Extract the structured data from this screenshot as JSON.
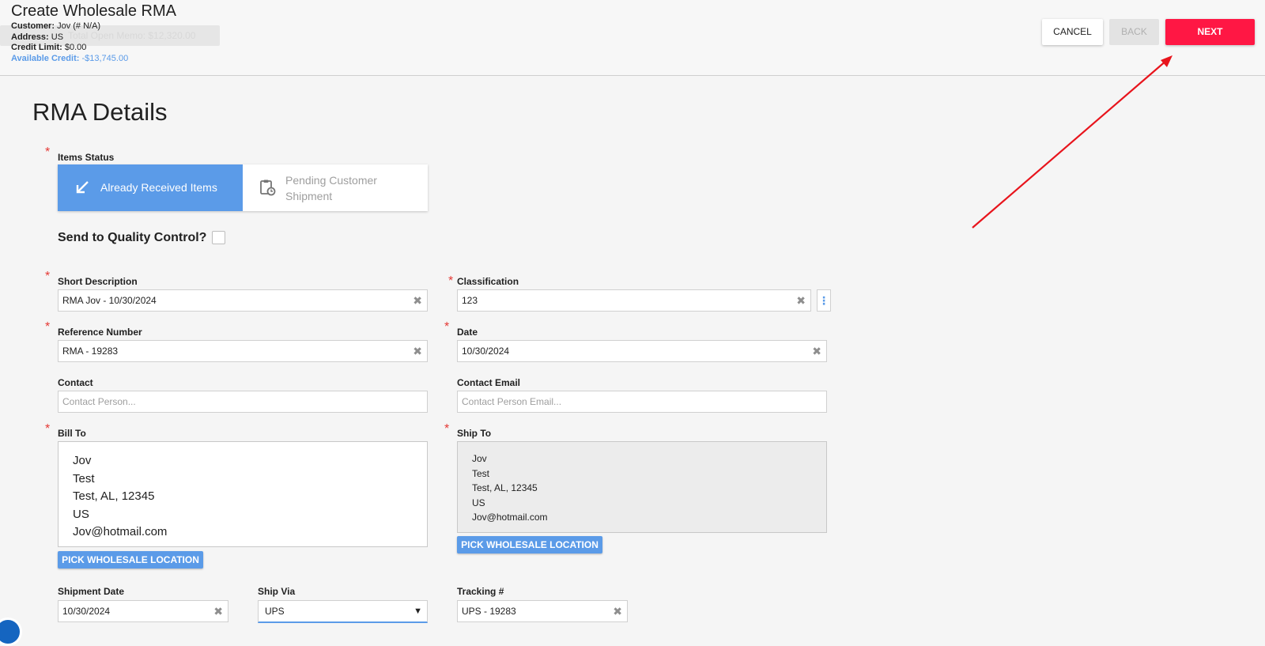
{
  "header": {
    "title": "Create Wholesale RMA",
    "ghost_memo": "Total Open Memo: $12,320.00",
    "customer_label": "Customer:",
    "customer_value": "Jov (# N/A)",
    "address_label": "Address:",
    "address_value": "US",
    "credit_limit_label": "Credit Limit:",
    "credit_limit_value": "$0.00",
    "available_credit_label": "Available Credit:",
    "available_credit_value": "-$13,745.00",
    "buttons": {
      "cancel": "CANCEL",
      "back": "BACK",
      "next": "NEXT"
    }
  },
  "section_title": "RMA Details",
  "required_mark": "*",
  "items_status": {
    "label": "Items Status",
    "options": [
      {
        "label": "Already Received Items",
        "icon": "arrow-down-left-icon",
        "selected": true
      },
      {
        "label": "Pending Customer Shipment",
        "icon": "clipboard-clock-icon",
        "selected": false
      }
    ]
  },
  "quality_control": {
    "label": "Send to Quality Control?",
    "checked": false
  },
  "form": {
    "short_description": {
      "label": "Short Description",
      "value": "RMA Jov - 10/30/2024",
      "clear": "✖"
    },
    "classification": {
      "label": "Classification",
      "value": "123",
      "clear": "✖",
      "menu": "⋮"
    },
    "reference_number": {
      "label": "Reference Number",
      "value": "RMA - 19283",
      "clear": "✖"
    },
    "date": {
      "label": "Date",
      "value": "10/30/2024",
      "clear": "✖"
    },
    "contact": {
      "label": "Contact",
      "placeholder": "Contact Person..."
    },
    "contact_email": {
      "label": "Contact Email",
      "placeholder": "Contact Person Email..."
    },
    "bill_to": {
      "label": "Bill To",
      "lines": [
        "Jov",
        "Test",
        "Test, AL, 12345",
        "US",
        "Jov@hotmail.com"
      ],
      "pick_button": "PICK WHOLESALE LOCATION"
    },
    "ship_to": {
      "label": "Ship To",
      "lines": [
        "Jov",
        "Test",
        "Test, AL, 12345",
        "US",
        "Jov@hotmail.com"
      ],
      "pick_button": "PICK WHOLESALE LOCATION"
    },
    "shipment_date": {
      "label": "Shipment Date",
      "value": "10/30/2024",
      "clear": "✖"
    },
    "ship_via": {
      "label": "Ship Via",
      "value": "UPS",
      "chevron": "▼"
    },
    "tracking": {
      "label": "Tracking #",
      "value": "UPS - 19283",
      "clear": "✖"
    }
  },
  "colors": {
    "accent_blue": "#5b9be8",
    "next_red": "#ff1744",
    "required_red": "#e53935",
    "annotation_arrow": "#e8141c"
  }
}
